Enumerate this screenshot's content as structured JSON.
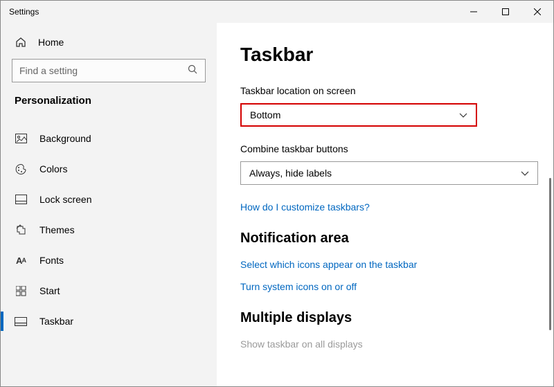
{
  "window": {
    "title": "Settings"
  },
  "sidebar": {
    "home": "Home",
    "search_placeholder": "Find a setting",
    "section": "Personalization",
    "items": [
      {
        "label": "Background"
      },
      {
        "label": "Colors"
      },
      {
        "label": "Lock screen"
      },
      {
        "label": "Themes"
      },
      {
        "label": "Fonts"
      },
      {
        "label": "Start"
      },
      {
        "label": "Taskbar"
      }
    ]
  },
  "main": {
    "title": "Taskbar",
    "location_label": "Taskbar location on screen",
    "location_value": "Bottom",
    "combine_label": "Combine taskbar buttons",
    "combine_value": "Always, hide labels",
    "link_customize": "How do I customize taskbars?",
    "notif_heading": "Notification area",
    "link_select_icons": "Select which icons appear on the taskbar",
    "link_system_icons": "Turn system icons on or off",
    "multi_heading": "Multiple displays",
    "show_all": "Show taskbar on all displays"
  }
}
